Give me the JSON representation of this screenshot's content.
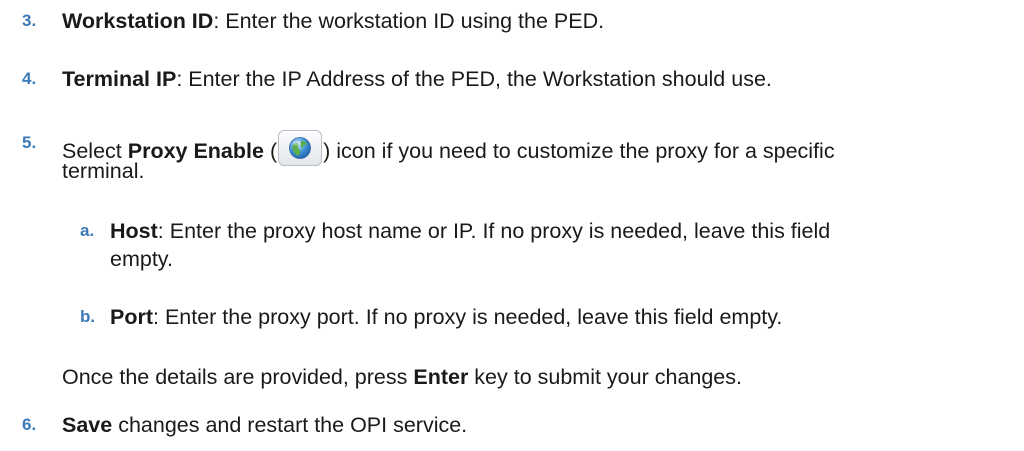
{
  "steps": [
    {
      "number": "3.",
      "bold": "Workstation ID",
      "text": ": Enter the workstation ID using the PED."
    },
    {
      "number": "4.",
      "bold": "Terminal IP",
      "text": ": Enter the IP Address of the PED, the Workstation should use."
    },
    {
      "number": "5.",
      "prefix": "Select ",
      "bold": "Proxy Enable",
      "paren_open": " (",
      "paren_close": ")",
      "line1_rest": " icon if you need to customize the proxy for a specific",
      "line2": "terminal.",
      "icon": "globe-icon",
      "substeps": [
        {
          "letter": "a.",
          "bold": "Host",
          "line1": ": Enter the proxy host name or IP. If no proxy is needed, leave this field",
          "line2": "empty."
        },
        {
          "letter": "b.",
          "bold": "Port",
          "line1": ": Enter the proxy port. If no proxy is needed, leave this field empty."
        }
      ],
      "note_prefix": "Once the details are provided, press ",
      "note_bold": "Enter",
      "note_suffix": " key to submit your changes."
    },
    {
      "number": "6.",
      "bold": "Save",
      "text": " changes and restart the OPI service."
    }
  ]
}
